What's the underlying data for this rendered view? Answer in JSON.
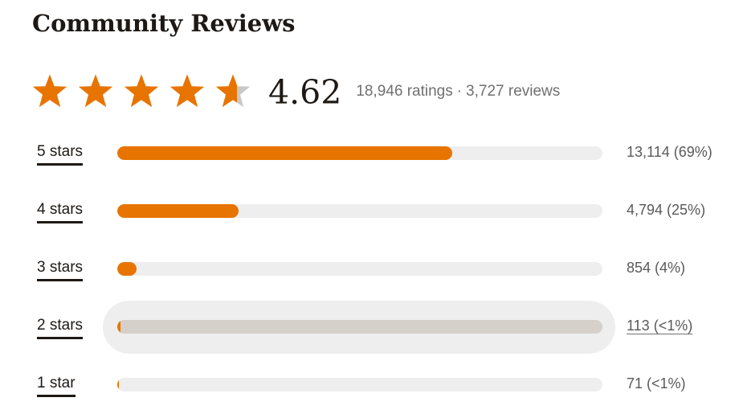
{
  "header": {
    "title": "Community Reviews"
  },
  "summary": {
    "average": "4.62",
    "average_value": 4.62,
    "ratings_text": "18,946 ratings",
    "separator": "·",
    "reviews_text": "3,727 reviews",
    "star_icon": "star-icon",
    "star_color": "#e87400",
    "star_empty_color": "#c8c8c8"
  },
  "histogram": [
    {
      "label": "5 stars",
      "count_text": "13,114 (69%)",
      "fraction": 0.69
    },
    {
      "label": "4 stars",
      "count_text": "4,794 (25%)",
      "fraction": 0.25
    },
    {
      "label": "3 stars",
      "count_text": "854 (4%)",
      "fraction": 0.04
    },
    {
      "label": "2 stars",
      "count_text": "113 (<1%)",
      "fraction": 0.006
    },
    {
      "label": "1 star",
      "count_text": "71 (<1%)",
      "fraction": 0.004
    }
  ],
  "colors": {
    "bar_fill": "#e87400",
    "bar_track": "#eeeeee",
    "bar_track_hover": "#d6d0cb",
    "hover_background": "#eeeeee"
  }
}
